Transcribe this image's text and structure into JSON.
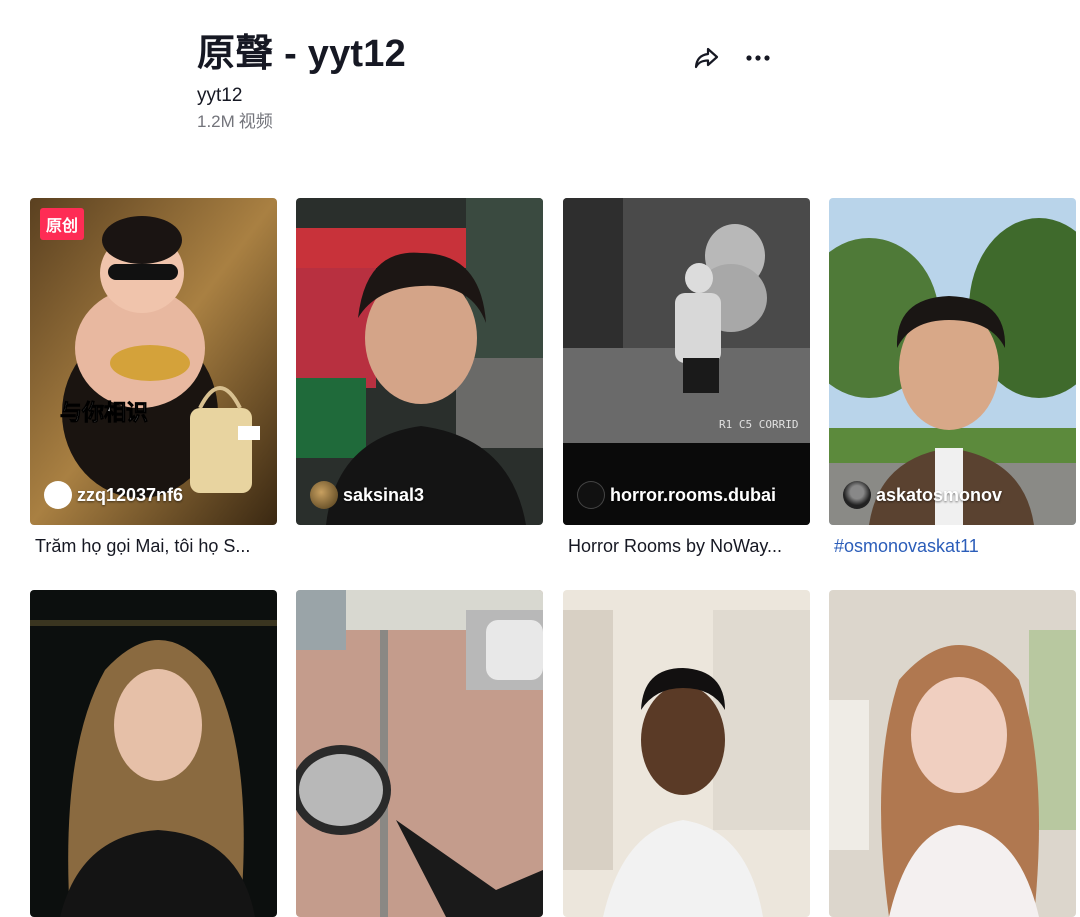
{
  "header": {
    "title": "原聲 - yyt12",
    "author": "yyt12",
    "video_count": "1.2M",
    "video_label": "视频"
  },
  "actions": {
    "share_icon": "share-arrow-icon",
    "more_icon": "more-dots-icon"
  },
  "videos": [
    {
      "badge": "原创",
      "overlay_text": "与你相识",
      "creator": "zzq12037nf6",
      "caption": "Trăm họ gọi Mai, tôi họ S..."
    },
    {
      "creator": "saksinal3",
      "caption": ""
    },
    {
      "creator": "horror.rooms.dubai",
      "caption": "Horror Rooms by NoWay...",
      "overlay_text": "R1 C5 CORRID"
    },
    {
      "creator": "askatosmonov",
      "caption": "#osmonovaskat11"
    },
    {
      "creator": "",
      "caption": ""
    },
    {
      "creator": "",
      "caption": ""
    },
    {
      "creator": "",
      "caption": ""
    },
    {
      "creator": "",
      "caption": ""
    }
  ],
  "colors": {
    "badge": "#fe2c55",
    "hashtag": "#2b5db9",
    "muted": "#73747b",
    "text": "#161823"
  }
}
